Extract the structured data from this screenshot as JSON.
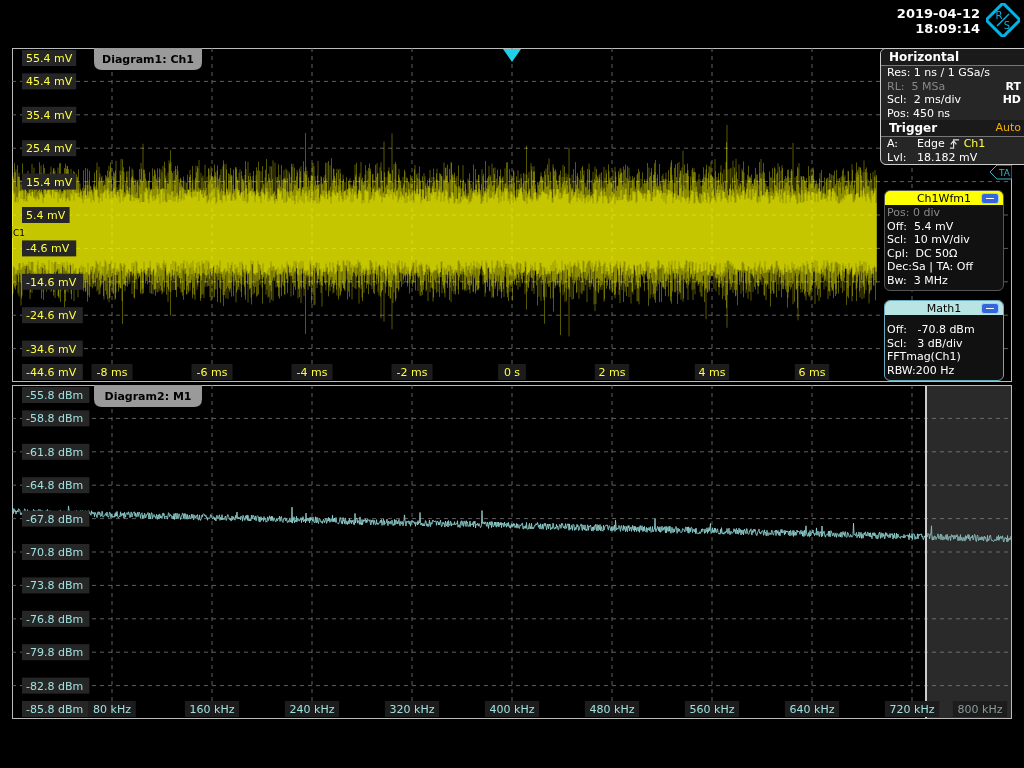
{
  "header": {
    "date": "2019-04-12",
    "time": "18:09:14",
    "logo_letters": [
      "R",
      "S"
    ]
  },
  "diagrams": [
    {
      "title": "Diagram1: Ch1",
      "kind": "time",
      "marker": "C1",
      "side_marker": "TA",
      "y_labels": [
        "55.4 mV",
        "45.4 mV",
        "35.4 mV",
        "25.4 mV",
        "15.4 mV",
        "5.4 mV",
        "-4.6 mV",
        "-14.6 mV",
        "-24.6 mV",
        "-34.6 mV",
        "-44.6 mV"
      ],
      "x_labels": [
        {
          "text": "-8 ms",
          "dimmed": false
        },
        {
          "text": "-6 ms",
          "dimmed": false
        },
        {
          "text": "-4 ms",
          "dimmed": false
        },
        {
          "text": "-2 ms",
          "dimmed": false
        },
        {
          "text": "0 s",
          "dimmed": false
        },
        {
          "text": "2 ms",
          "dimmed": false
        },
        {
          "text": "4 ms",
          "dimmed": false
        },
        {
          "text": "6 ms",
          "dimmed": false
        }
      ]
    },
    {
      "title": "Diagram2: M1",
      "kind": "spectrum",
      "y_labels": [
        "-55.8 dBm",
        "-58.8 dBm",
        "-61.8 dBm",
        "-64.8 dBm",
        "-67.8 dBm",
        "-70.8 dBm",
        "-73.8 dBm",
        "-76.8 dBm",
        "-79.8 dBm",
        "-82.8 dBm",
        "-85.8 dBm"
      ],
      "x_labels": [
        {
          "text": "80 kHz",
          "dimmed": false
        },
        {
          "text": "160 kHz",
          "dimmed": false
        },
        {
          "text": "240 kHz",
          "dimmed": false
        },
        {
          "text": "320 kHz",
          "dimmed": false
        },
        {
          "text": "400 kHz",
          "dimmed": false
        },
        {
          "text": "480 kHz",
          "dimmed": false
        },
        {
          "text": "560 kHz",
          "dimmed": false
        },
        {
          "text": "640 kHz",
          "dimmed": false
        },
        {
          "text": "720 kHz",
          "dimmed": false
        },
        {
          "text": "800 kHz",
          "dimmed": true
        }
      ]
    }
  ],
  "horizontal": {
    "title": "Horizontal",
    "rows": [
      {
        "text": "Res: 1 ns / 1 GSa/s",
        "disabled": false
      },
      {
        "text": "RL:  5 MSa",
        "disabled": true,
        "flag": "RT"
      },
      {
        "text": "Scl:  2 ms/div",
        "disabled": false,
        "flag": "HD"
      },
      {
        "text": "Pos: 450 ns",
        "disabled": false
      }
    ]
  },
  "trigger": {
    "title": "Trigger",
    "mode": "Auto",
    "rows": [
      {
        "kind": "edge",
        "label": "A:",
        "value": "Edge",
        "source": "Ch1"
      },
      {
        "kind": "plain",
        "label": "Lvl:",
        "value": "18.182 mV"
      }
    ]
  },
  "boxes": [
    {
      "title": "Ch1Wfm1",
      "kind": "channel",
      "rows": [
        {
          "text": "Pos: 0 div",
          "disabled": true
        },
        {
          "text": "Off:  5.4 mV",
          "disabled": false
        },
        {
          "text": "Scl:  10 mV/div",
          "disabled": false
        },
        {
          "text": "Cpl:  DC 50Ω",
          "disabled": false
        },
        {
          "text": "Dec:Sa | TA: Off",
          "disabled": false
        },
        {
          "text": "Bw:  3 MHz",
          "disabled": false
        }
      ]
    },
    {
      "title": "Math1",
      "kind": "math",
      "rows": [
        {
          "text": "Off:   -70.8 dBm",
          "disabled": false
        },
        {
          "text": "Scl:   3 dB/div",
          "disabled": false
        },
        {
          "text": "FFTmag(Ch1)",
          "disabled": false
        },
        {
          "text": "RBW:200 Hz",
          "disabled": false
        }
      ]
    }
  ]
}
